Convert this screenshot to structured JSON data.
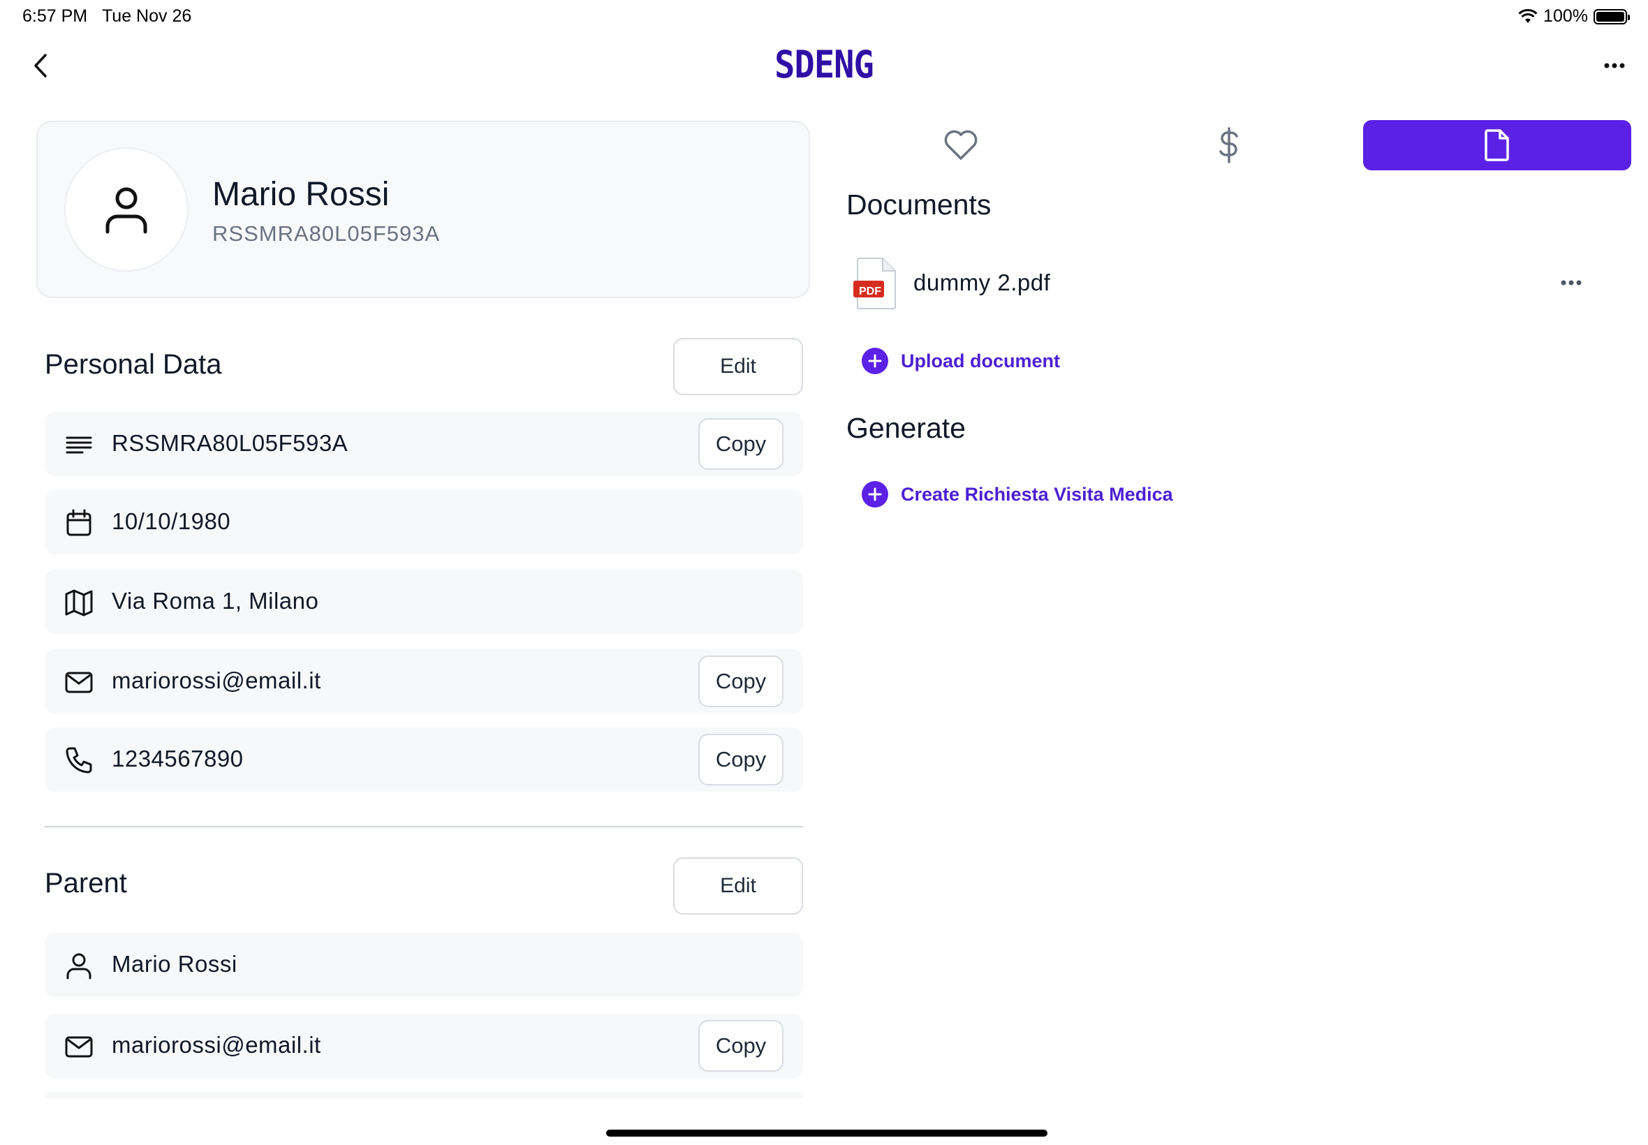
{
  "status_bar": {
    "time": "6:57 PM",
    "date": "Tue Nov 26",
    "battery": "100%"
  },
  "nav": {
    "logo": "SDENG",
    "back_icon": "chevron-left-icon",
    "more_icon": "ellipsis-icon"
  },
  "profile": {
    "name": "Mario Rossi",
    "code": "RSSMRA80L05F593A",
    "avatar_icon": "user-icon"
  },
  "personal_data": {
    "title": "Personal Data",
    "edit_label": "Edit",
    "rows": [
      {
        "icon": "text-lines-icon",
        "value": "RSSMRA80L05F593A",
        "copy": "Copy"
      },
      {
        "icon": "calendar-icon",
        "value": "10/10/1980"
      },
      {
        "icon": "map-icon",
        "value": "Via Roma 1, Milano"
      },
      {
        "icon": "mail-icon",
        "value": "mariorossi@email.it",
        "copy": "Copy"
      },
      {
        "icon": "phone-icon",
        "value": "1234567890",
        "copy": "Copy"
      }
    ]
  },
  "parent": {
    "title": "Parent",
    "edit_label": "Edit",
    "rows": [
      {
        "icon": "user-icon",
        "value": "Mario Rossi"
      },
      {
        "icon": "mail-icon",
        "value": "mariorossi@email.it",
        "copy": "Copy"
      }
    ]
  },
  "tabs": [
    {
      "icon": "heart-icon",
      "active": false
    },
    {
      "icon": "dollar-icon",
      "active": false
    },
    {
      "icon": "document-icon",
      "active": true
    }
  ],
  "documents": {
    "title": "Documents",
    "items": [
      {
        "name": "dummy 2.pdf",
        "type": "PDF"
      }
    ],
    "upload_label": "Upload document"
  },
  "generate": {
    "title": "Generate",
    "create_label": "Create Richiesta Visita Medica"
  },
  "colors": {
    "accent": "#5b21e6",
    "logo": "#2f0fa6",
    "card_bg": "#f8f9fb",
    "row_bg": "#f7f8fa"
  }
}
